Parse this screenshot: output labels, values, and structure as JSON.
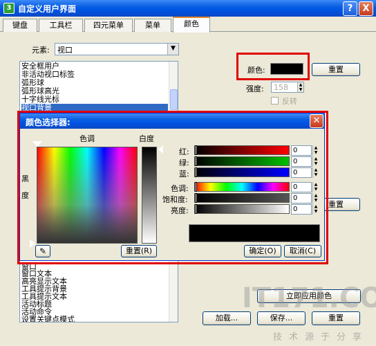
{
  "window": {
    "title": "自定义用户界面",
    "help": "?",
    "close": "X",
    "app_icon": "3"
  },
  "tabs": [
    "键盘",
    "工具栏",
    "四元菜单",
    "菜单",
    "颜色"
  ],
  "element": {
    "label": "元素:",
    "value": "视口"
  },
  "list_top": [
    "安全框用户",
    "非活动视口标签",
    "弧形球",
    "弧形球高光",
    "十字线光标",
    "视口背景"
  ],
  "list_bottom": [
    "窗口",
    "窗口文本",
    "高亮显示文本",
    "工具提示背景",
    "工具提示文本",
    "活动标题",
    "活动命令",
    "设置关键点模式"
  ],
  "color": {
    "label": "颜色:",
    "value": "#000000",
    "reset": "重置"
  },
  "intensity": {
    "label": "强度:",
    "value": "158"
  },
  "invert": {
    "label": "反转"
  },
  "reset2": "重置",
  "apply_colors": "立即应用颜色",
  "load": "加载...",
  "save": "保存...",
  "reset3": "重置",
  "dialog": {
    "title": "颜色选择器:",
    "hue_label": "色调",
    "whiteness_label": "白度",
    "black_label_1": "黑",
    "black_label_2": "度",
    "reset": "重置(R)",
    "ok": "确定(O)",
    "cancel": "取消(C)",
    "sliders": [
      {
        "label": "红:",
        "value": "0"
      },
      {
        "label": "绿:",
        "value": "0"
      },
      {
        "label": "蓝:",
        "value": "0"
      },
      {
        "label": "色调:",
        "value": "0"
      },
      {
        "label": "饱和度:",
        "value": "0"
      },
      {
        "label": "亮度:",
        "value": "0"
      }
    ]
  },
  "watermark": {
    "main": "IT171.COM",
    "sub": "技术源于分享"
  }
}
